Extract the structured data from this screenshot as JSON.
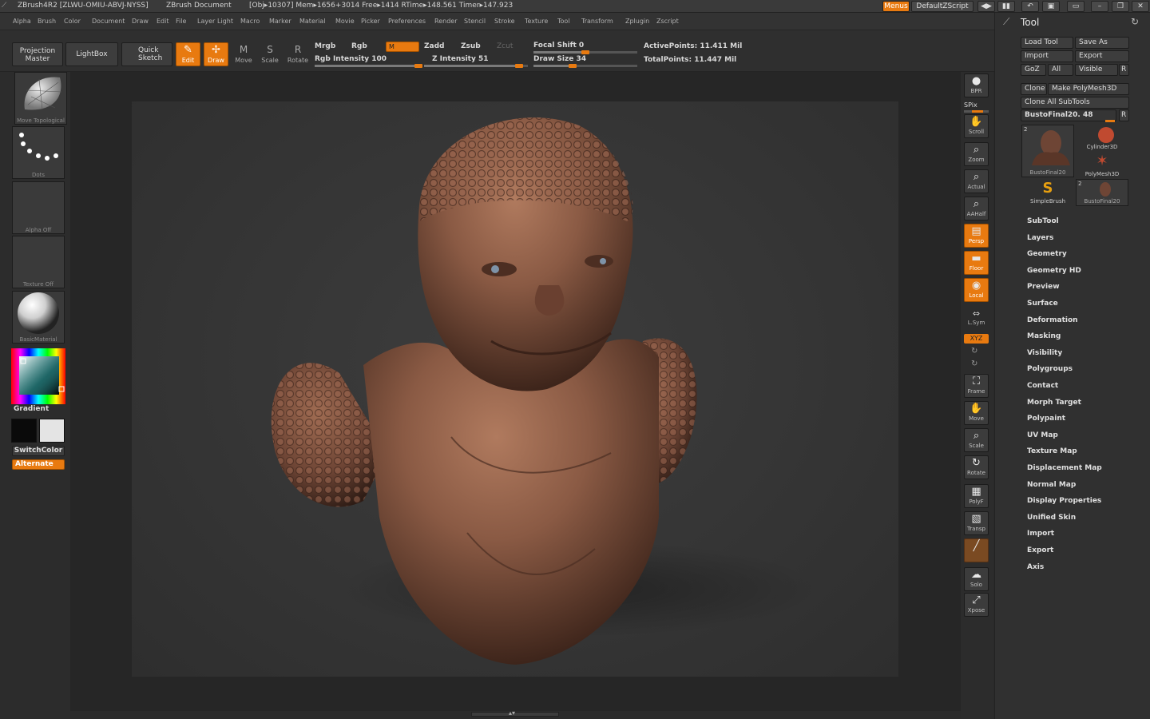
{
  "titlebar": {
    "app": "ZBrush4R2 [ZLWU-OMIU-ABVJ-NYSS]",
    "doc": "ZBrush Document",
    "stats": "[Obj▸10307] Mem▸1656+3014 Free▸1414 RTime▸148.561 Timer▸147.923",
    "menus_btn": "Menus",
    "script_btn": "DefaultZScript"
  },
  "menubar": [
    "Alpha",
    "Brush",
    "Color",
    "Document",
    "Draw",
    "Edit",
    "File",
    "Layer",
    "Light",
    "Macro",
    "Marker",
    "Material",
    "Movie",
    "Picker",
    "Preferences",
    "Render",
    "Stencil",
    "Stroke",
    "Texture",
    "Tool",
    "Transform",
    "Zplugin",
    "Zscript"
  ],
  "shelf": {
    "projection_master": "Projection Master",
    "lightbox": "LightBox",
    "quick_sketch": "Quick Sketch",
    "edit": "Edit",
    "draw": "Draw",
    "move": "Move",
    "scale": "Scale",
    "rotate": "Rotate",
    "mrgb": "Mrgb",
    "rgb": "Rgb",
    "m": "M",
    "rgb_intensity": "Rgb Intensity 100",
    "zadd": "Zadd",
    "zsub": "Zsub",
    "zcut": "Zcut",
    "z_intensity": "Z Intensity 51",
    "focal_shift": "Focal Shift 0",
    "draw_size": "Draw Size 34",
    "active_points": "ActivePoints: 11.411 Mil",
    "total_points": "TotalPoints: 11.447 Mil",
    "rgb_intensity_value": 100,
    "z_intensity_value": 51,
    "focal_shift_value": 0,
    "draw_size_value": 34
  },
  "left": {
    "brush_caption": "Move Topological",
    "stroke_caption": "Dots",
    "alpha_caption": "Alpha Off",
    "texture_caption": "Texture Off",
    "material_caption": "BasicMaterial",
    "gradient": "Gradient",
    "switchcolor": "SwitchColor",
    "alternate": "Alternate",
    "main_color": "#0a0a0a",
    "secondary_color": "#e4e4e4"
  },
  "rightbar": [
    {
      "name": "bpr",
      "cap": "BPR",
      "icon": "sphere-icon",
      "glyph": "●",
      "orange": false
    },
    {
      "name": "scroll",
      "cap": "Scroll",
      "icon": "hand-icon",
      "glyph": "✋",
      "orange": false
    },
    {
      "name": "zoom",
      "cap": "Zoom",
      "icon": "magnifier-icon",
      "glyph": "⌕",
      "orange": false
    },
    {
      "name": "actual",
      "cap": "Actual",
      "icon": "magnifier-icon",
      "glyph": "⌕",
      "orange": false
    },
    {
      "name": "aahalf",
      "cap": "AAHalf",
      "icon": "magnifier-icon",
      "glyph": "⌕",
      "orange": false
    },
    {
      "name": "persp",
      "cap": "Persp",
      "icon": "grid-icon",
      "glyph": "▤",
      "orange": true
    },
    {
      "name": "floor",
      "cap": "Floor",
      "icon": "floor-icon",
      "glyph": "▬",
      "orange": true
    },
    {
      "name": "local",
      "cap": "Local",
      "icon": "local-icon",
      "glyph": "◉",
      "orange": true
    },
    {
      "name": "lsym",
      "cap": "L.Sym",
      "icon": "symmetry-icon",
      "glyph": "⇔",
      "orange": false
    },
    {
      "name": "frame",
      "cap": "Frame",
      "icon": "frame-icon",
      "glyph": "⛶",
      "orange": false
    },
    {
      "name": "move",
      "cap": "Move",
      "icon": "hand-icon",
      "glyph": "✋",
      "orange": false
    },
    {
      "name": "scale",
      "cap": "Scale",
      "icon": "magnifier-icon",
      "glyph": "⌕",
      "orange": false
    },
    {
      "name": "rotate",
      "cap": "Rotate",
      "icon": "rotate-icon",
      "glyph": "↻",
      "orange": false
    },
    {
      "name": "polyf",
      "cap": "PolyF",
      "icon": "grid-icon",
      "glyph": "▦",
      "orange": false
    },
    {
      "name": "transp",
      "cap": "Transp",
      "icon": "transp-icon",
      "glyph": "▧",
      "orange": false
    },
    {
      "name": "ghost",
      "cap": "",
      "icon": "ghost-icon",
      "glyph": "╱",
      "orange": false
    },
    {
      "name": "solo",
      "cap": "Solo",
      "icon": "solo-icon",
      "glyph": "☁",
      "orange": false
    },
    {
      "name": "xpose",
      "cap": "Xpose",
      "icon": "xpose-icon",
      "glyph": "⤢",
      "orange": false
    }
  ],
  "rightbar_extra": {
    "spix": "SPix",
    "xyz": "XYZ"
  },
  "tool": {
    "title": "Tool",
    "load_tool": "Load Tool",
    "save_as": "Save As",
    "import": "Import",
    "export": "Export",
    "goz": "GoZ",
    "all": "All",
    "visible": "Visible",
    "r": "R",
    "clone": "Clone",
    "make_polymesh": "Make PolyMesh3D",
    "clone_all": "Clone All SubTools",
    "current": "BustoFinal20. 48",
    "thumbs": [
      {
        "cap": "BustoFinal20",
        "badge": "2"
      },
      {
        "cap": "Cylinder3D",
        "badge": ""
      },
      {
        "cap": "PolyMesh3D",
        "badge": ""
      },
      {
        "cap": "SimpleBrush",
        "badge": ""
      },
      {
        "cap": "BustoFinal20",
        "badge": "2"
      }
    ],
    "sections": [
      "SubTool",
      "Layers",
      "Geometry",
      "Geometry HD",
      "Preview",
      "Surface",
      "Deformation",
      "Masking",
      "Visibility",
      "Polygroups",
      "Contact",
      "Morph Target",
      "Polypaint",
      "UV Map",
      "Texture Map",
      "Displacement Map",
      "Normal Map",
      "Display Properties",
      "Unified Skin",
      "Import",
      "Export",
      "Axis"
    ]
  },
  "colors": {
    "accent": "#e87a10",
    "clay": "#8a5a44"
  }
}
